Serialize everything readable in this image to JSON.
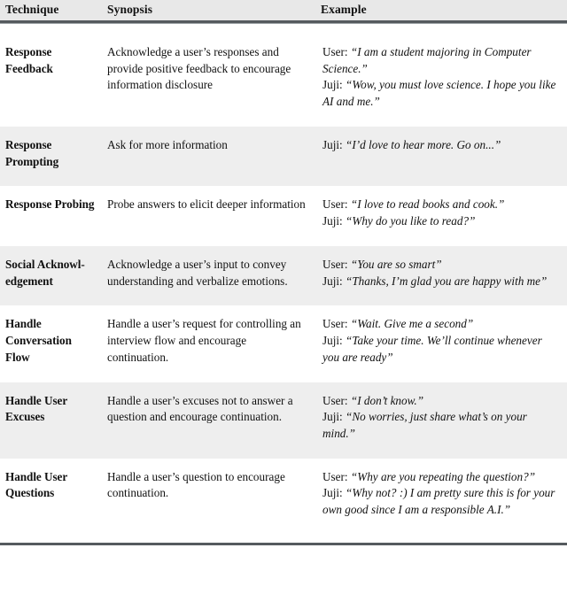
{
  "table": {
    "caption_visible": false,
    "columns": [
      {
        "key": "technique",
        "label": "Technique"
      },
      {
        "key": "synopsis",
        "label": "Synopsis"
      },
      {
        "key": "example",
        "label": "Example"
      }
    ],
    "style": {
      "header_background": "#e8e8e8",
      "shaded_row_background": "#eeeeee",
      "plain_row_background": "#ffffff",
      "rule_color": "#555a5e",
      "thin_rule_color": "#9aa0a4",
      "text_color": "#111111"
    },
    "rows": [
      {
        "shaded": false,
        "technique": "Response Feedback",
        "synopsis": "Acknowledge a user’s responses and provide positive feedback to encourage information disclosure",
        "example": [
          {
            "speaker": "User:",
            "quote": "“I am a student majoring in Computer Science.”"
          },
          {
            "speaker": "Juji:",
            "quote": "“Wow, you must love science. I hope you like AI and me.”"
          }
        ]
      },
      {
        "shaded": true,
        "technique": "Response Prompting",
        "synopsis": "Ask for more information",
        "example": [
          {
            "speaker": "Juji:",
            "quote": "“I’d love to hear more. Go on...”"
          }
        ]
      },
      {
        "shaded": false,
        "technique": "Response Probing",
        "synopsis": "Probe answers to elicit deeper information",
        "example": [
          {
            "speaker": "User:",
            "quote": "“I love to read books and cook.”"
          },
          {
            "speaker": "Juji:",
            "quote": "“Why do you like to read?”"
          }
        ]
      },
      {
        "shaded": true,
        "technique": "Social Acknowl-edgement",
        "synopsis": "Acknowledge a user’s input to convey understanding and verbalize emotions.",
        "example": [
          {
            "speaker": "User:",
            "quote": "“You are so smart”"
          },
          {
            "speaker": "Juji:",
            "quote": "“Thanks, I’m glad you are happy with me”"
          }
        ]
      },
      {
        "shaded": false,
        "technique": "Handle Conversation Flow",
        "synopsis": "Handle a user’s request for controlling an interview flow and encourage continuation.",
        "example": [
          {
            "speaker": "User:",
            "quote": "“Wait. Give me a second”"
          },
          {
            "speaker": "Juji:",
            "quote": "“Take your time. We’ll continue whenever you are ready”"
          }
        ]
      },
      {
        "shaded": true,
        "technique": "Handle User Excuses",
        "synopsis": "Handle a user’s excuses not to answer a question and encourage continuation.",
        "example": [
          {
            "speaker": "User:",
            "quote": "“I don’t know.”"
          },
          {
            "speaker": "Juji:",
            "quote": "“No worries, just share what’s on your mind.”"
          }
        ]
      },
      {
        "shaded": false,
        "technique": "Handle User Questions",
        "synopsis": "Handle a user’s question to encourage continuation.",
        "example": [
          {
            "speaker": "User:",
            "quote": "“Why are you repeating the question?”"
          },
          {
            "speaker": "Juji:",
            "quote": "“Why not? :) I am pretty sure this is for your own good since I am a responsible A.I.”"
          }
        ]
      }
    ]
  }
}
